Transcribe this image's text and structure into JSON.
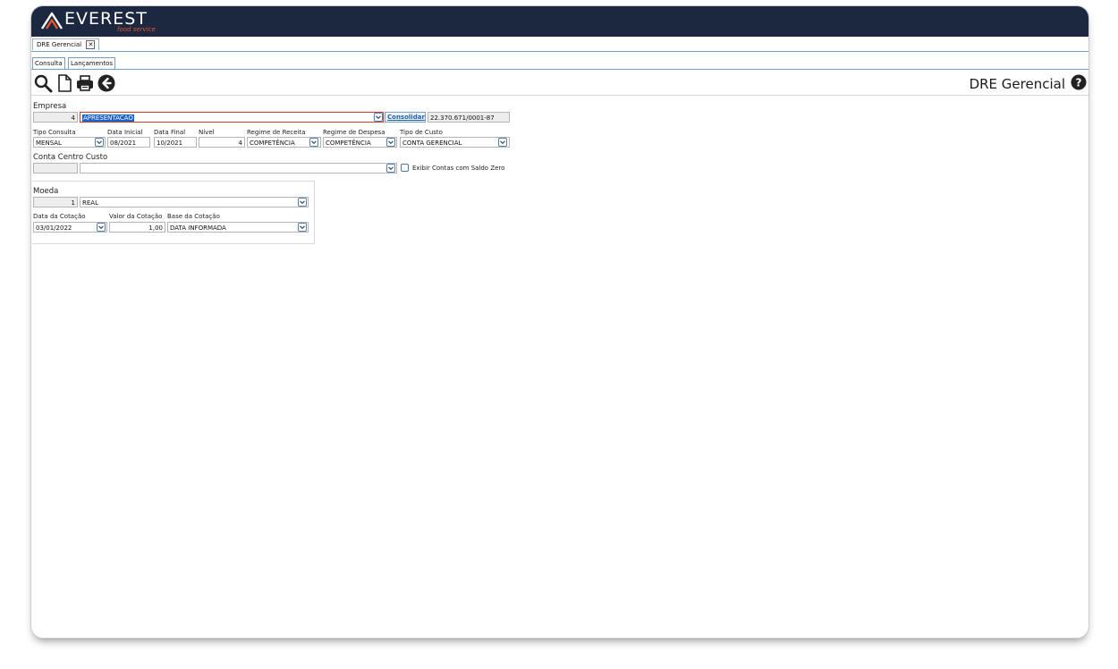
{
  "brand": {
    "name": "EVEREST",
    "tagline": "food service"
  },
  "doc_tab": {
    "label": "DRE Gerencial"
  },
  "subtabs": [
    "Consulta",
    "Lançamentos"
  ],
  "page_title": "DRE Gerencial",
  "icons": {
    "search": "search-icon",
    "new": "new-document-icon",
    "print": "print-icon",
    "back": "back-icon",
    "help": "help-icon"
  },
  "empresa": {
    "label": "Empresa",
    "code": "4",
    "name": "APRESENTACAO",
    "consolidar": "Consolidar",
    "cnpj": "22.370.671/0001-87"
  },
  "filters": {
    "tipo_consulta": {
      "label": "Tipo Consulta",
      "value": "MENSAL"
    },
    "data_inicial": {
      "label": "Data Inicial",
      "value": "08/2021"
    },
    "data_final": {
      "label": "Data Final",
      "value": "10/2021"
    },
    "nivel": {
      "label": "Nível",
      "value": "4"
    },
    "regime_receita": {
      "label": "Regime de Receita",
      "value": "COMPETÊNCIA"
    },
    "regime_despesa": {
      "label": "Regime de Despesa",
      "value": "COMPETÊNCIA"
    },
    "tipo_custo": {
      "label": "Tipo de Custo",
      "value": "CONTA GERENCIAL"
    }
  },
  "centro_custo": {
    "label": "Conta Centro Custo",
    "code": "",
    "value": "",
    "checkbox_label": "Exibir Contas com Saldo Zero",
    "checked": false
  },
  "moeda": {
    "label": "Moeda",
    "code": "1",
    "value": "REAL",
    "data_cotacao": {
      "label": "Data da Cotação",
      "value": "03/01/2022"
    },
    "valor_cotacao": {
      "label": "Valor da Cotação",
      "value": "1,00"
    },
    "base_cotacao": {
      "label": "Base da Cotação",
      "value": "DATA INFORMADA"
    }
  },
  "colors": {
    "header": "#1c2740",
    "accent": "#e3572b",
    "selection": "#1c62c7"
  }
}
